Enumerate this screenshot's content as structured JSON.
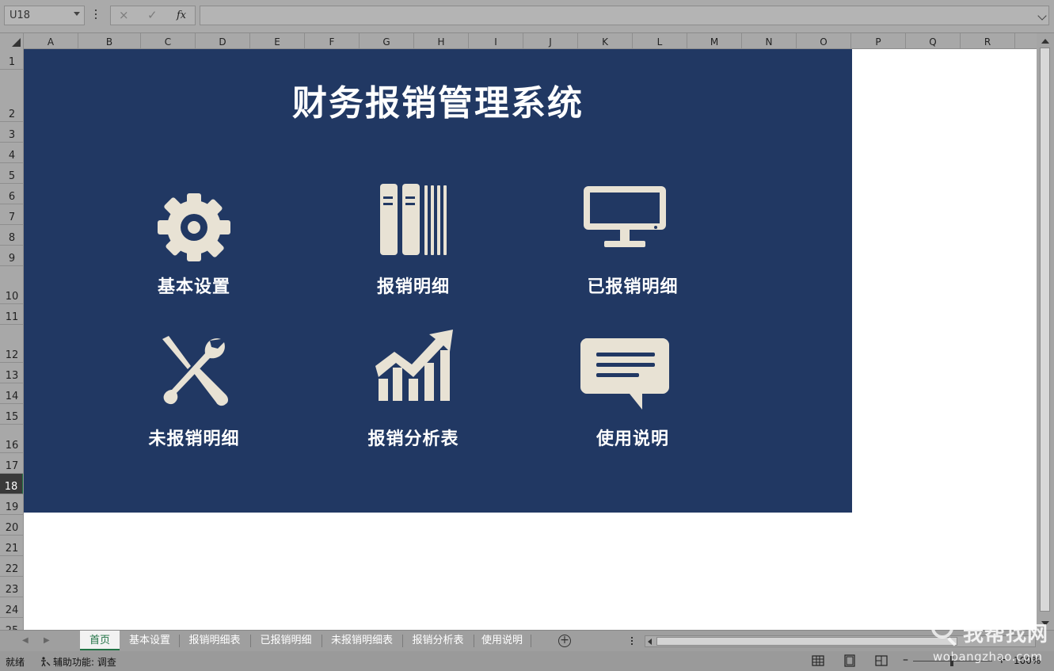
{
  "formula_bar": {
    "name_box": "U18",
    "cancel_icon": "×",
    "enter_icon": "✓",
    "fx_label": "fx",
    "formula_value": ""
  },
  "columns": [
    "A",
    "B",
    "C",
    "D",
    "E",
    "F",
    "G",
    "H",
    "I",
    "J",
    "K",
    "L",
    "M",
    "N",
    "O",
    "P",
    "Q",
    "R"
  ],
  "rows": [
    "1",
    "2",
    "3",
    "4",
    "5",
    "6",
    "7",
    "8",
    "9",
    "10",
    "11",
    "12",
    "13",
    "14",
    "15",
    "16",
    "17",
    "18",
    "19",
    "20",
    "21",
    "22",
    "23",
    "24",
    "25"
  ],
  "selected_row": "18",
  "dashboard": {
    "title": "财务报销管理系统",
    "background": "#213863",
    "icon_color": "#e8e2d4",
    "tiles": [
      {
        "label": "基本设置",
        "icon": "gear-icon"
      },
      {
        "label": "报销明细",
        "icon": "books-icon"
      },
      {
        "label": "已报销明细",
        "icon": "monitor-icon"
      },
      {
        "label": "未报销明细",
        "icon": "tools-icon"
      },
      {
        "label": "报销分析表",
        "icon": "chart-trend-icon"
      },
      {
        "label": "使用说明",
        "icon": "speech-bubble-icon"
      }
    ]
  },
  "sheet_tabs": [
    "首页",
    "基本设置",
    "报销明细表",
    "已报销明细",
    "未报销明细表",
    "报销分析表",
    "使用说明"
  ],
  "active_tab": "首页",
  "status_bar": {
    "ready": "就绪",
    "accessibility": "辅助功能: 调查",
    "zoom": "100%"
  },
  "watermark": {
    "brand": "我帮找网",
    "url": "wobangzhao.com"
  }
}
